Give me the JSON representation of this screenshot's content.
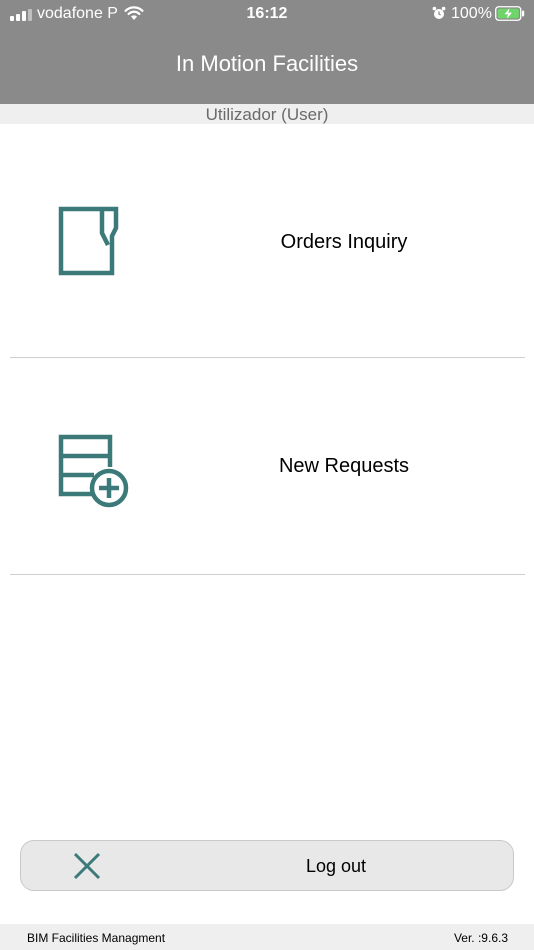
{
  "status_bar": {
    "carrier": "vodafone P",
    "time": "16:12",
    "battery_percent": "100%",
    "signal_bars": 3,
    "signal_bars_total": 4,
    "icons": [
      "signal-icon",
      "wifi-icon",
      "alarm-icon",
      "battery-charging-icon"
    ]
  },
  "header": {
    "title": "In Motion Facilities"
  },
  "user_bar": {
    "label": "Utilizador (User)"
  },
  "menu": {
    "items": [
      {
        "label": "Orders Inquiry",
        "icon": "document-icon"
      },
      {
        "label": "New Requests",
        "icon": "add-request-icon"
      }
    ]
  },
  "logout": {
    "label": "Log out",
    "icon": "close-icon"
  },
  "footer": {
    "app_name": "BIM Facilities Managment",
    "version": "Ver. :9.6.3"
  },
  "colors": {
    "header_bg": "#8a8a8a",
    "accent_teal": "#3b7a78",
    "panel_bg": "#efefef"
  }
}
